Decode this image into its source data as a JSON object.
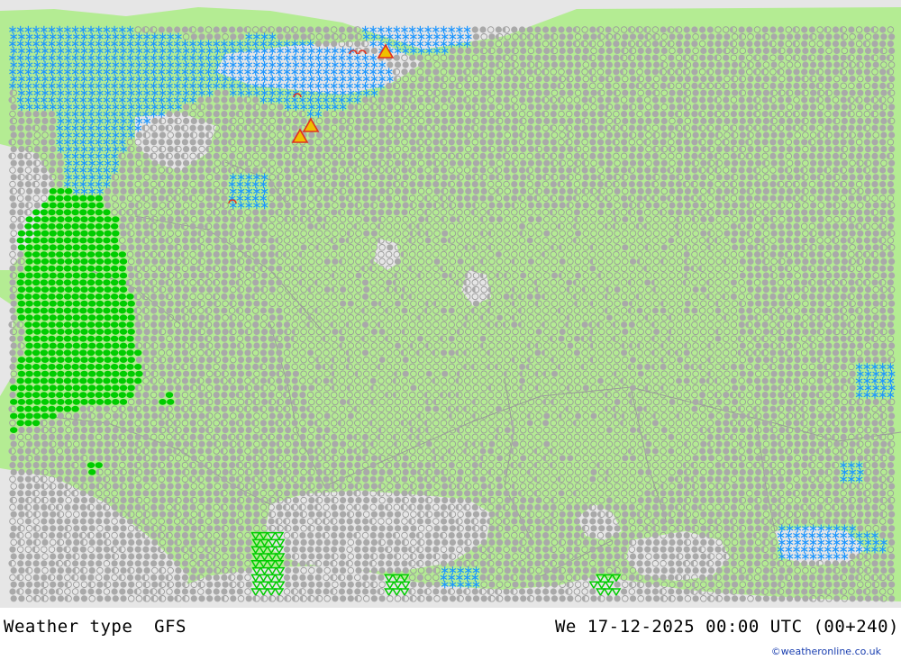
{
  "map": {
    "colors": {
      "land": "#b4ec93",
      "sea": "#e6e6e6",
      "border": "#9a9a9a",
      "cloud_overcast": "#a9a9a9",
      "cloud_clear_outline": "#9a9a9a",
      "rain": "#00cc00",
      "snow": "#1e96ff",
      "thunder": "#e03020",
      "thunder_fill": "#f0c000"
    },
    "symbols": {
      "overcast": "filled-circle",
      "partly_cloudy": "half-circle",
      "clear": "open-circle",
      "rain": "green-dot",
      "snow": "blue-asterisk",
      "shower": "triangle-down",
      "thunderstorm": "triangle-warning"
    }
  },
  "footer": {
    "title": "Weather type  GFS",
    "timestamp": "We 17-12-2025 00:00 UTC (00+240)",
    "credit": "©weatheronline.co.uk"
  }
}
